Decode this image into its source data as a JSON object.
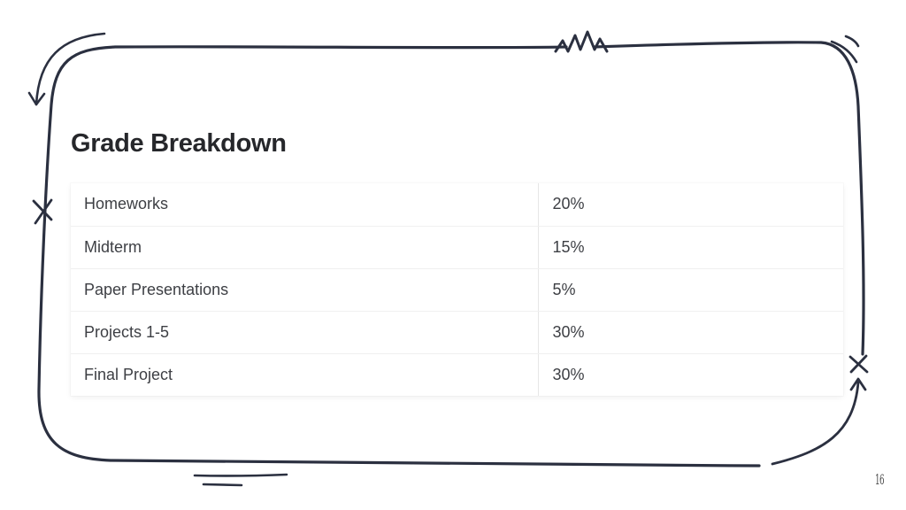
{
  "slide": {
    "title": "Grade Breakdown",
    "page_number": "16"
  },
  "grade_breakdown": {
    "rows": [
      {
        "item": "Homeworks",
        "weight": "20%"
      },
      {
        "item": "Midterm",
        "weight": "15%"
      },
      {
        "item": "Paper Presentations",
        "weight": "5%"
      },
      {
        "item": "Projects 1-5",
        "weight": "30%"
      },
      {
        "item": "Final Project",
        "weight": "30%"
      }
    ]
  },
  "colors": {
    "frame_stroke": "#2b3040",
    "title_text": "#26272b",
    "cell_text": "#3d3f44",
    "background": "#ffffff"
  },
  "decorations": [
    "hand-drawn-rounded-frame",
    "curved-arrow-top-left",
    "zigzag-top",
    "double-arc-top-right",
    "cross-mark-left",
    "cross-mark-right",
    "arrow-up-bottom-right",
    "double-underline-bottom"
  ]
}
